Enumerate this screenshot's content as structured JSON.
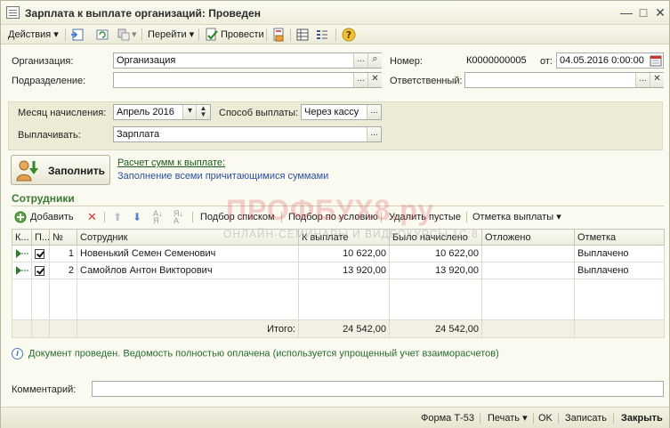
{
  "window": {
    "title": "Зарплата к выплате организаций: Проведен",
    "minimize": "—",
    "maximize": "□",
    "close": "✕"
  },
  "toolbar": {
    "actions": "Действия",
    "goto": "Перейти",
    "post": "Провести"
  },
  "header": {
    "org_label": "Организация:",
    "org_value": "Организация",
    "dept_label": "Подразделение:",
    "dept_value": "",
    "number_label": "Номер:",
    "number_value": "К0000000005",
    "date_label": "от:",
    "date_value": "04.05.2016  0:00:00",
    "responsible_label": "Ответственный:",
    "responsible_value": ""
  },
  "params": {
    "month_label": "Месяц начисления:",
    "month_value": "Апрель 2016",
    "method_label": "Способ выплаты:",
    "method_value": "Через кассу",
    "pay_label": "Выплачивать:",
    "pay_value": "Зарплата"
  },
  "fill": {
    "button_label": "Заполнить",
    "link_text": "Расчет сумм к выплате:",
    "description": "Заполнение всеми причитающимися суммами"
  },
  "employees": {
    "section_title": "Сотрудники",
    "toolbar": {
      "add": "Добавить",
      "pick_list": "Подбор списком",
      "pick_cond": "Подбор по условию",
      "delete_empty": "Удалить пустые",
      "mark_payment": "Отметка выплаты"
    },
    "columns": [
      "К...",
      "П...",
      "№",
      "Сотрудник",
      "К выплате",
      "Было начислено",
      "Отложено",
      "Отметка"
    ],
    "rows": [
      {
        "num": "1",
        "name": "Новенький Семен Семенович",
        "to_pay": "10 622,00",
        "accrued": "10 622,00",
        "deferred": "",
        "mark": "Выплачено"
      },
      {
        "num": "2",
        "name": "Самойлов Антон Викторович",
        "to_pay": "13 920,00",
        "accrued": "13 920,00",
        "deferred": "",
        "mark": "Выплачено"
      }
    ],
    "total_label": "Итого:",
    "total_to_pay": "24 542,00",
    "total_accrued": "24 542,00"
  },
  "info": {
    "message": "Документ проведен. Ведомость полностью оплачена (используется упрощенный учет взаиморасчетов)"
  },
  "comment": {
    "label": "Комментарий:",
    "value": ""
  },
  "footer": {
    "form": "Форма Т-53",
    "print": "Печать",
    "ok": "OK",
    "save": "Записать",
    "close": "Закрыть"
  },
  "watermark": {
    "line1": "ПРОФБУХ8.ру",
    "line2": "ОНЛАЙН-СЕМИНАРЫ И ВИДЕОКУРСЫ 1С:8"
  },
  "colors": {
    "panel_bg": "#ecebd6",
    "window_bg": "#fbfaf1",
    "section_title": "#3b7a32",
    "info_text": "#256b2c"
  }
}
